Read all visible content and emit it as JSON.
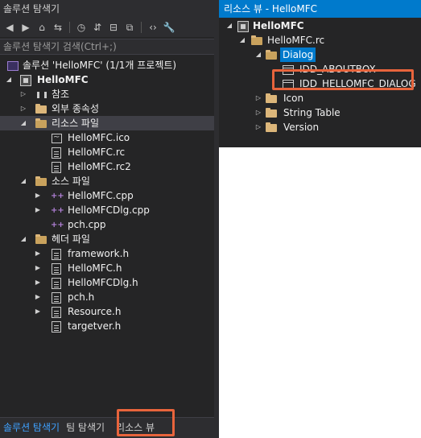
{
  "solution_explorer": {
    "title": "솔루션 탐색기",
    "search_placeholder": "솔루션 탐색기 검색(Ctrl+;)",
    "solution_label": "솔루션 'HelloMFC' (1/1개 프로젝트)",
    "project": "HelloMFC",
    "references": "참조",
    "external_deps": "외부 종속성",
    "resource_files": "리소스 파일",
    "resource_items": [
      "HelloMFC.ico",
      "HelloMFC.rc",
      "HelloMFC.rc2"
    ],
    "source_files": "소스 파일",
    "source_items": [
      "HelloMFC.cpp",
      "HelloMFCDlg.cpp",
      "pch.cpp"
    ],
    "header_files": "헤더 파일",
    "header_items": [
      "framework.h",
      "HelloMFC.h",
      "HelloMFCDlg.h",
      "pch.h",
      "Resource.h",
      "targetver.h"
    ]
  },
  "bottom_tabs": [
    "솔루션 탐색기",
    "팀 탐색기",
    "리소스 뷰"
  ],
  "resource_view": {
    "title": "리소스 뷰 - HelloMFC",
    "root": "HelloMFC",
    "rc_file": "HelloMFC.rc",
    "dialog_folder": "Dialog",
    "dialog_items": [
      "IDD_ABOUTBOX",
      "IDD_HELLOMFC_DIALOG"
    ],
    "other_folders": [
      "Icon",
      "String Table",
      "Version"
    ]
  },
  "colors": {
    "accent": "#007acc",
    "highlight": "#e8643c",
    "folder": "#dcb67a",
    "background": "#252526"
  }
}
